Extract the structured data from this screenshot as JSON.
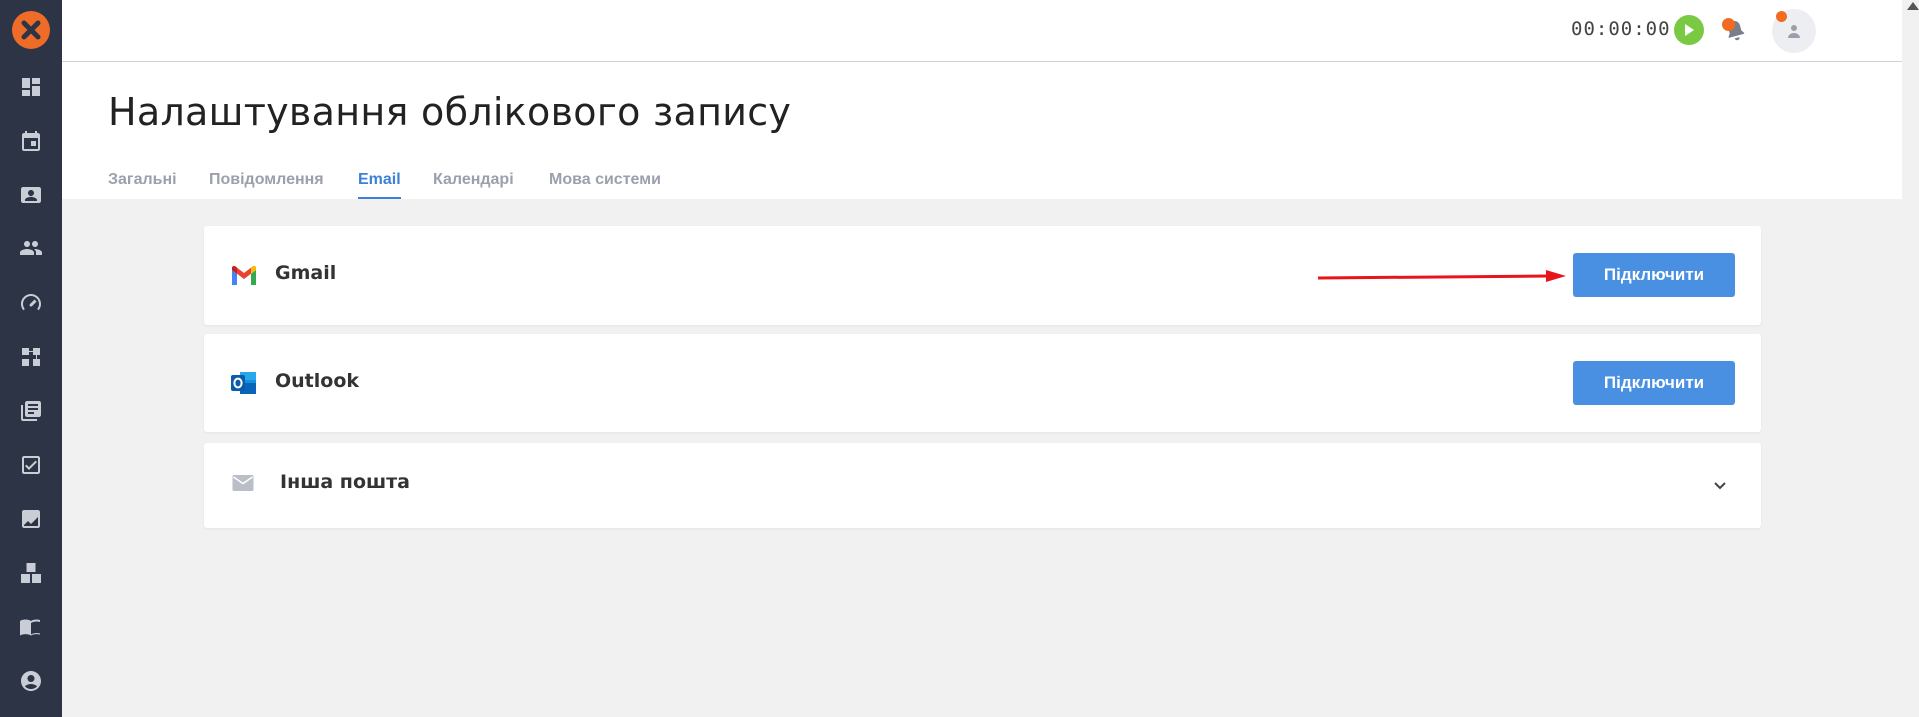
{
  "timer": "00:00:00",
  "page_title": "Налаштування облікового запису",
  "tabs": [
    "Загальні",
    "Повідомлення",
    "Email",
    "Календарі",
    "Мова системи"
  ],
  "active_tab": "Email",
  "email_providers": [
    {
      "name": "Gmail",
      "icon": "gmail-icon",
      "button": "Підключити"
    },
    {
      "name": "Outlook",
      "icon": "outlook-icon",
      "button": "Підключити"
    },
    {
      "name": "Інша пошта",
      "icon": "envelope-icon"
    }
  ],
  "sidebar_icons": [
    "dashboard-icon",
    "calendar-icon",
    "contacts-icon",
    "users-icon",
    "speedometer-icon",
    "workflow-icon",
    "library-icon",
    "task-icon",
    "chart-icon",
    "boxes-icon",
    "book-icon",
    "account-icon"
  ],
  "colors": {
    "sidebar": "#2d3445",
    "accent": "#4a90e2",
    "brand": "#ee6c28",
    "play": "#7ac943",
    "notify": "#f36b21",
    "arrow": "#e8141c"
  }
}
